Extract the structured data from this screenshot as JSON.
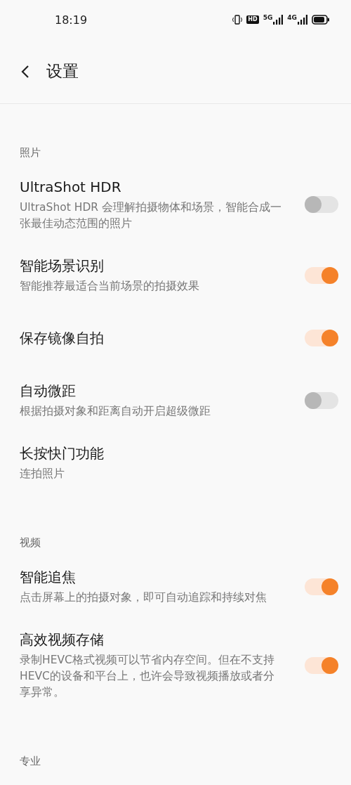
{
  "status_bar": {
    "time": "18:19",
    "hd_badge": "HD",
    "signals": [
      {
        "label": "5G"
      },
      {
        "label": "4G"
      }
    ]
  },
  "header": {
    "title": "设置"
  },
  "sections": [
    {
      "title": "照片",
      "items": [
        {
          "title": "UltraShot HDR",
          "description": "UltraShot HDR 会理解拍摄物体和场景，智能合成一张最佳动态范围的照片",
          "kind": "toggle",
          "on": false
        },
        {
          "title": "智能场景识别",
          "description": "智能推荐最适合当前场景的拍摄效果",
          "kind": "toggle",
          "on": true
        },
        {
          "title": "保存镜像自拍",
          "kind": "toggle",
          "on": true
        },
        {
          "title": "自动微距",
          "description": "根据拍摄对象和距离自动开启超级微距",
          "kind": "toggle",
          "on": false
        },
        {
          "title": "长按快门功能",
          "description": "连拍照片",
          "kind": "link"
        }
      ]
    },
    {
      "title": "视频",
      "items": [
        {
          "title": "智能追焦",
          "description": "点击屏幕上的拍摄对象，即可自动追踪和持续对焦",
          "kind": "toggle",
          "on": true
        },
        {
          "title": "高效视频存储",
          "description": "录制HEVC格式视频可以节省内存空间。但在不支持HEVC的设备和平台上，也许会导致视频播放或者分享异常。",
          "kind": "toggle",
          "on": true
        }
      ]
    },
    {
      "title": "专业"
    }
  ]
}
